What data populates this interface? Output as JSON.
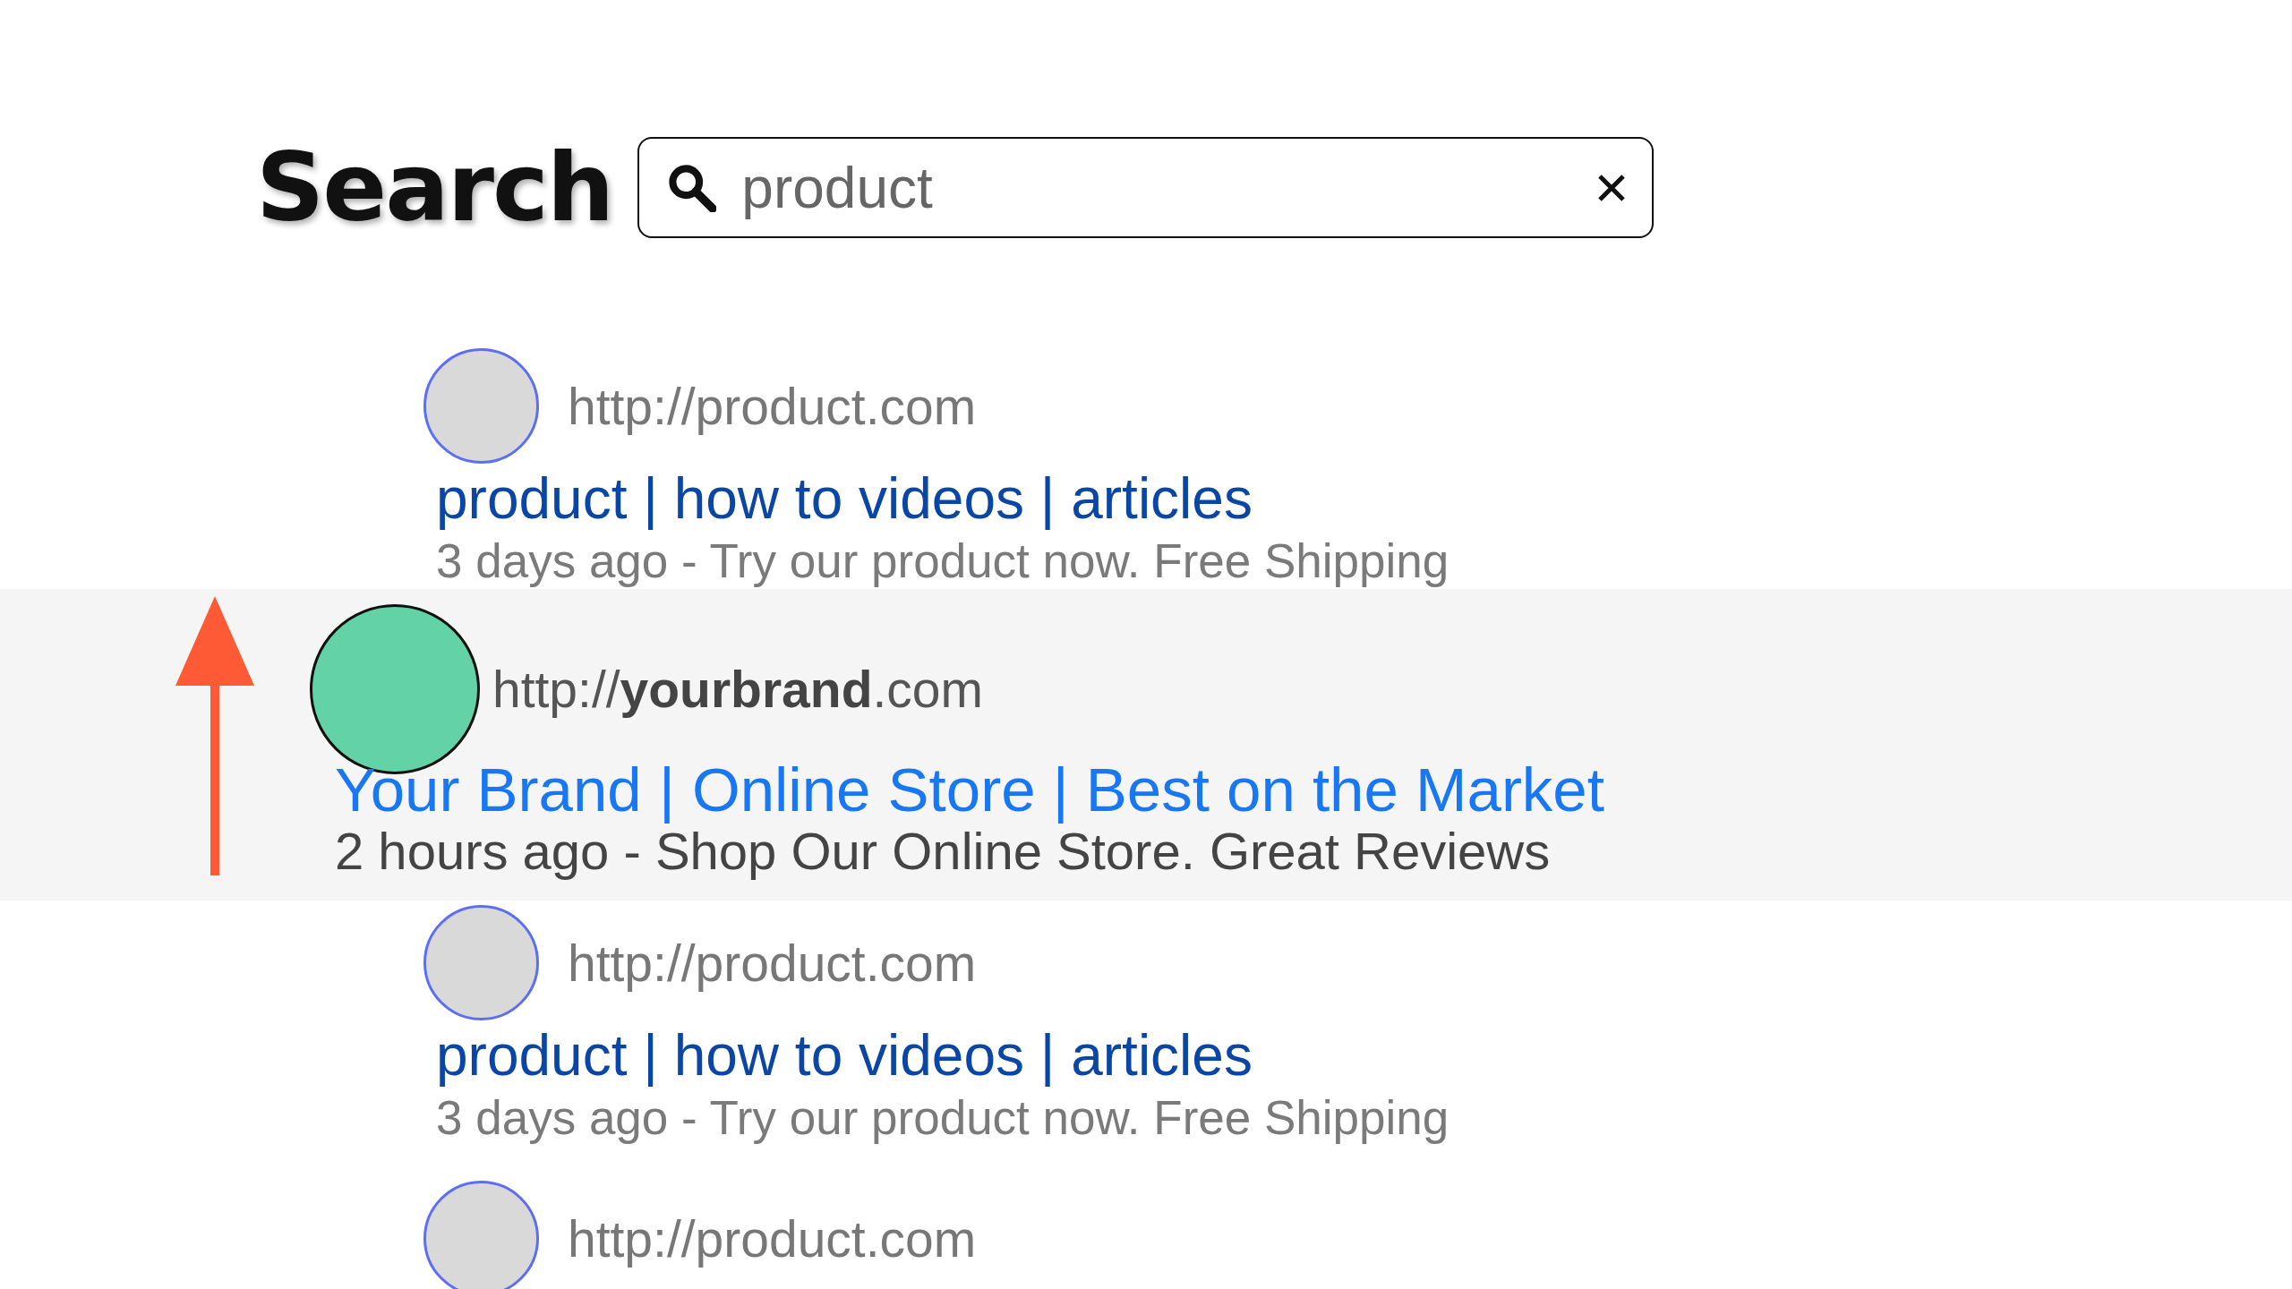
{
  "header": {
    "title": "Search",
    "query": "product"
  },
  "results": [
    {
      "kind": "normal",
      "url": "http://product.com",
      "title": "product | how to videos | articles",
      "snippet": "3 days ago - Try our product now. Free Shipping"
    },
    {
      "kind": "featured",
      "url": "http://**yourbrand**.com",
      "title": "Your Brand | Online Store | Best on the Market",
      "snippet": "2 hours ago - Shop Our Online Store. Great Reviews"
    },
    {
      "kind": "normal",
      "url": "http://product.com",
      "title": "product | how to videos | articles",
      "snippet": "3 days ago - Try our product now. Free Shipping"
    },
    {
      "kind": "normal",
      "url": "http://product.com"
    }
  ]
}
